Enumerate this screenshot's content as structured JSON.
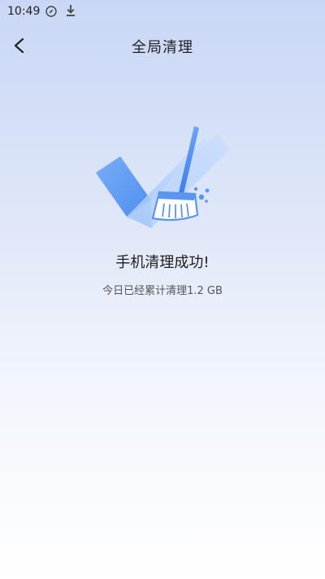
{
  "status_bar": {
    "time": "10:49",
    "icons": [
      "compass-icon",
      "download-icon"
    ]
  },
  "header": {
    "back_icon": "chevron-left-icon",
    "title": "全局清理"
  },
  "result": {
    "illustration": "broom-checkmark-icon",
    "title": "手机清理成功!",
    "subtitle": "今日已经累计清理1.2 GB"
  },
  "colors": {
    "background_top": "#c9d7f6",
    "background_bottom": "#ffffff",
    "accent_blue": "#4f8ff0"
  }
}
